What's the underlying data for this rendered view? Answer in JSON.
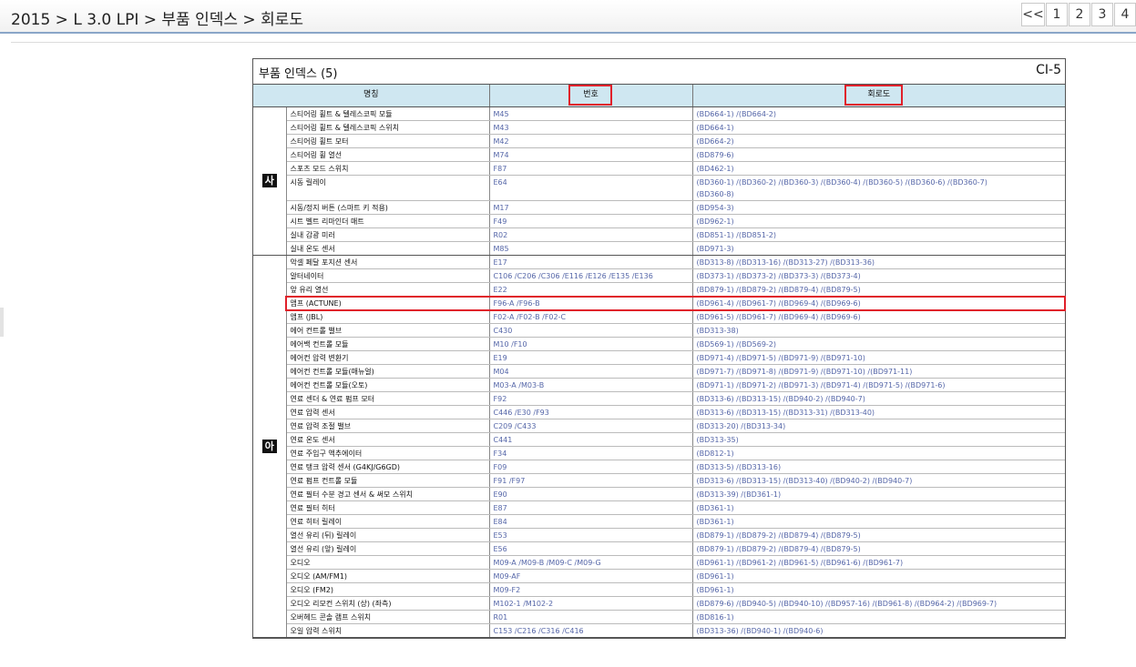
{
  "breadcrumb": "2015 > L 3.0 LPI > 부품 인덱스 > 회로도",
  "pager": {
    "prev": "<<",
    "pages": [
      "1",
      "2",
      "3",
      "4"
    ]
  },
  "doc": {
    "title": "부품 인덱스 (5)",
    "code": "CI-5",
    "headers": {
      "name": "명칭",
      "number": "번호",
      "circuit": "회로도"
    },
    "groups": [
      {
        "label": "사",
        "rows": [
          {
            "name": "스티어링 휠트 & 텔레스코픽 모듈",
            "number": "M45",
            "circuit": "(BD664-1) /(BD664-2)"
          },
          {
            "name": "스티어링 휠트 & 텔레스코픽 스위치",
            "number": "M43",
            "circuit": "(BD664-1)"
          },
          {
            "name": "스티어링 휠트 모터",
            "number": "M42",
            "circuit": "(BD664-2)"
          },
          {
            "name": "스티어링 휠 열선",
            "number": "M74",
            "circuit": "(BD879-6)"
          },
          {
            "name": "스포츠 모드 스위치",
            "number": "F87",
            "circuit": "(BD462-1)"
          },
          {
            "name": "시동 릴레이",
            "number": "E64",
            "circuit": "(BD360-1) /(BD360-2) /(BD360-3) /(BD360-4) /(BD360-5) /(BD360-6) /(BD360-7)",
            "circuit2": "(BD360-8)"
          },
          {
            "name": "시동/정지 버튼 (스마트 키 적용)",
            "number": "M17",
            "circuit": "(BD954-3)"
          },
          {
            "name": "시트 벨트 리마인더 매트",
            "number": "F49",
            "circuit": "(BD962-1)"
          },
          {
            "name": "실내 감광 미러",
            "number": "R02",
            "circuit": "(BD851-1) /(BD851-2)"
          },
          {
            "name": "실내 온도 센서",
            "number": "M85",
            "circuit": "(BD971-3)"
          }
        ]
      },
      {
        "label": "아",
        "rows": [
          {
            "name": "악셀 페달 포지션 센서",
            "number": "E17",
            "circuit": "(BD313-8) /(BD313-16) /(BD313-27) /(BD313-36)"
          },
          {
            "name": "알터네이터",
            "number": "C106 /C206 /C306 /E116 /E126 /E135 /E136",
            "circuit": "(BD373-1) /(BD373-2) /(BD373-3) /(BD373-4)"
          },
          {
            "name": "앞 유리 열선",
            "number": "E22",
            "circuit": "(BD879-1) /(BD879-2) /(BD879-4) /(BD879-5)"
          },
          {
            "name": "앰프 (ACTUNE)",
            "number": "F96-A /F96-B",
            "circuit": "(BD961-4) /(BD961-7) /(BD969-4) /(BD969-6)",
            "highlight": true
          },
          {
            "name": "앰프 (JBL)",
            "number": "F02-A /F02-B /F02-C",
            "circuit": "(BD961-5) /(BD961-7) /(BD969-4) /(BD969-6)"
          },
          {
            "name": "에어 컨트롤 밸브",
            "number": "C430",
            "circuit": "(BD313-38)"
          },
          {
            "name": "에어백 컨트롤 모듈",
            "number": "M10 /F10",
            "circuit": "(BD569-1) /(BD569-2)"
          },
          {
            "name": "에어컨 압력 변환기",
            "number": "E19",
            "circuit": "(BD971-4) /(BD971-5) /(BD971-9) /(BD971-10)"
          },
          {
            "name": "에어컨 컨트롤 모듈(매뉴얼)",
            "number": "M04",
            "circuit": "(BD971-7) /(BD971-8) /(BD971-9) /(BD971-10) /(BD971-11)"
          },
          {
            "name": "에어컨 컨트롤 모듈(오토)",
            "number": "M03-A /M03-B",
            "circuit": "(BD971-1) /(BD971-2) /(BD971-3) /(BD971-4) /(BD971-5) /(BD971-6)"
          },
          {
            "name": "연료 센더 & 연료 펌프 모터",
            "number": "F92",
            "circuit": "(BD313-6) /(BD313-15) /(BD940-2) /(BD940-7)"
          },
          {
            "name": "연료 압력 센서",
            "number": "C446 /E30 /F93",
            "circuit": "(BD313-6) /(BD313-15) /(BD313-31) /(BD313-40)"
          },
          {
            "name": "연료 압력 조절 밸브",
            "number": "C209 /C433",
            "circuit": "(BD313-20) /(BD313-34)"
          },
          {
            "name": "연료 온도 센서",
            "number": "C441",
            "circuit": "(BD313-35)"
          },
          {
            "name": "연료 주입구 액추에이터",
            "number": "F34",
            "circuit": "(BD812-1)"
          },
          {
            "name": "연료 탱크 압력 센서 (G4KJ/G6GD)",
            "number": "F09",
            "circuit": "(BD313-5) /(BD313-16)"
          },
          {
            "name": "연료 펌프 컨트롤 모듈",
            "number": "F91 /F97",
            "circuit": "(BD313-6) /(BD313-15) /(BD313-40) /(BD940-2) /(BD940-7)"
          },
          {
            "name": "연료 필터 수분 경고 센서 & 써모 스위치",
            "number": "E90",
            "circuit": "(BD313-39) /(BD361-1)"
          },
          {
            "name": "연료 필터 히터",
            "number": "E87",
            "circuit": "(BD361-1)"
          },
          {
            "name": "연료 히터 릴레이",
            "number": "E84",
            "circuit": "(BD361-1)"
          },
          {
            "name": "열선 유리 (뒤) 릴레이",
            "number": "E53",
            "circuit": "(BD879-1) /(BD879-2) /(BD879-4) /(BD879-5)"
          },
          {
            "name": "열선 유리 (앞) 릴레이",
            "number": "E56",
            "circuit": "(BD879-1) /(BD879-2) /(BD879-4) /(BD879-5)"
          },
          {
            "name": "오디오",
            "number": "M09-A /M09-B /M09-C /M09-G",
            "circuit": "(BD961-1) /(BD961-2) /(BD961-5) /(BD961-6) /(BD961-7)"
          },
          {
            "name": "오디오 (AM/FM1)",
            "number": "M09-AF",
            "circuit": "(BD961-1)"
          },
          {
            "name": "오디오 (FM2)",
            "number": "M09-F2",
            "circuit": "(BD961-1)"
          },
          {
            "name": "오디오 리모컨 스위치 (상) (좌측)",
            "number": "M102-1 /M102-2",
            "circuit": "(BD879-6) /(BD940-5) /(BD940-10) /(BD957-16) /(BD961-8) /(BD964-2) /(BD969-7)"
          },
          {
            "name": "오버헤드 콘솔 램프 스위치",
            "number": "R01",
            "circuit": "(BD816-1)"
          },
          {
            "name": "오일 압력 스위치",
            "number": "C153 /C216 /C316 /C416",
            "circuit": "(BD313-36) /(BD940-1) /(BD940-6)"
          }
        ]
      }
    ]
  }
}
